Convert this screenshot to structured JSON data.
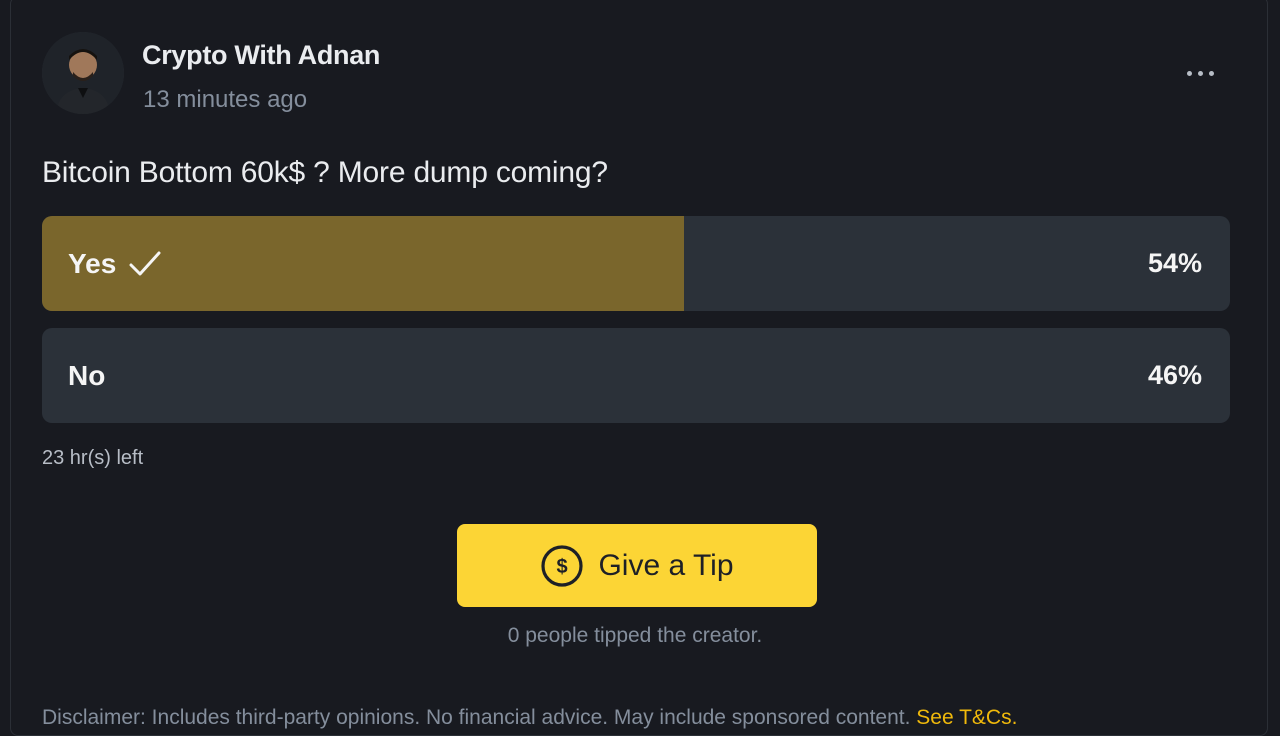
{
  "post": {
    "author": "Crypto With Adnan",
    "time": "13 minutes ago",
    "question": "Bitcoin Bottom 60k$ ? More dump coming?"
  },
  "poll": {
    "options": [
      {
        "label": "Yes",
        "percent_text": "54%",
        "fraction": 0.54,
        "selected": true
      },
      {
        "label": "No",
        "percent_text": "46%",
        "fraction": 0.46,
        "selected": false
      }
    ],
    "time_left": "23 hr(s) left",
    "fill_color": "#7a662c",
    "track_color": "#2b3139"
  },
  "tip": {
    "button_label": "Give a Tip",
    "icon": "dollar-circle-icon",
    "count_text": "0 people tipped the creator."
  },
  "disclaimer": {
    "text": "Disclaimer: Includes third-party opinions. No financial advice. May include sponsored content.",
    "link": "See T&Cs."
  },
  "colors": {
    "background": "#181a20",
    "accent": "#fcd535",
    "link": "#f0b90b"
  }
}
